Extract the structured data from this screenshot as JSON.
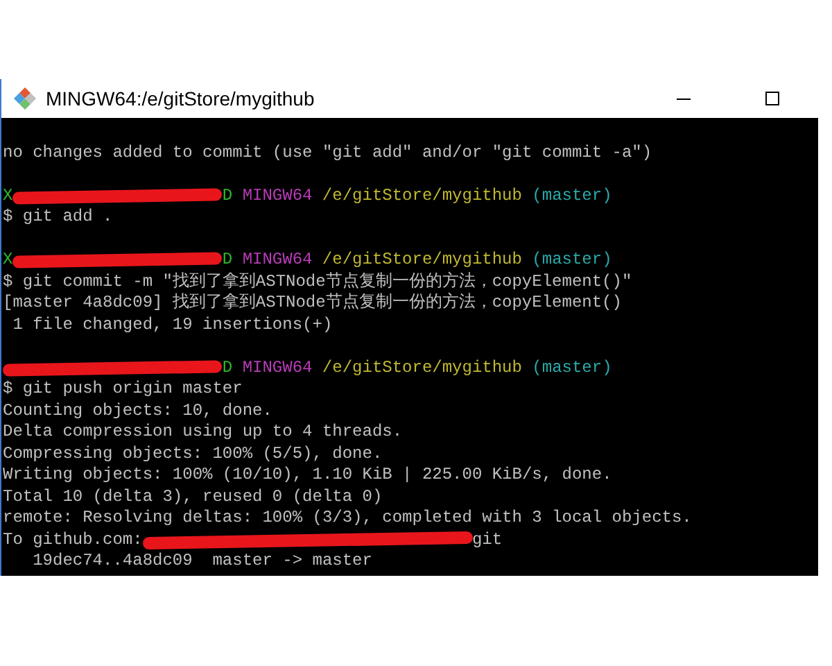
{
  "window": {
    "title": "MINGW64:/e/gitStore/mygithub",
    "controls": [
      {
        "kind": "minimize"
      },
      {
        "kind": "maximize"
      }
    ]
  },
  "terminal": {
    "lines": [
      {
        "kind": "blank"
      },
      {
        "kind": "output",
        "segments": [
          {
            "kind": "text",
            "text": "no changes added to commit (use \"git add\" and/or \"git commit -a\")",
            "color": "#c0c0c0"
          }
        ]
      },
      {
        "kind": "blank"
      },
      {
        "kind": "prompt",
        "segments": [
          {
            "kind": "text",
            "text": "X",
            "color": "#2eb82e"
          },
          {
            "kind": "redaction"
          },
          {
            "kind": "text",
            "text": "D",
            "color": "#2eb82e"
          },
          {
            "kind": "text",
            "text": " MINGW64",
            "color": "#b83cb8"
          },
          {
            "kind": "text",
            "text": " /e/gitStore/mygithub",
            "color": "#c0b830"
          },
          {
            "kind": "text",
            "text": " (master)",
            "color": "#2aa8a8"
          }
        ]
      },
      {
        "kind": "output",
        "segments": [
          {
            "kind": "text",
            "text": "$ git add .",
            "color": "#c0c0c0"
          }
        ]
      },
      {
        "kind": "blank"
      },
      {
        "kind": "prompt",
        "segments": [
          {
            "kind": "text",
            "text": "X",
            "color": "#2eb82e"
          },
          {
            "kind": "redaction"
          },
          {
            "kind": "text",
            "text": "D",
            "color": "#2eb82e"
          },
          {
            "kind": "text",
            "text": " MINGW64",
            "color": "#b83cb8"
          },
          {
            "kind": "text",
            "text": " /e/gitStore/mygithub",
            "color": "#c0b830"
          },
          {
            "kind": "text",
            "text": " (master)",
            "color": "#2aa8a8"
          }
        ]
      },
      {
        "kind": "output",
        "segments": [
          {
            "kind": "text",
            "text": "$ git commit -m \"找到了拿到ASTNode节点复制一份的方法，copyElement()\"",
            "color": "#c0c0c0"
          }
        ]
      },
      {
        "kind": "output",
        "segments": [
          {
            "kind": "text",
            "text": "[master 4a8dc09] 找到了拿到ASTNode节点复制一份的方法，copyElement()",
            "color": "#c0c0c0"
          }
        ]
      },
      {
        "kind": "output",
        "segments": [
          {
            "kind": "text",
            "text": " 1 file changed, 19 insertions(+)",
            "color": "#c0c0c0"
          }
        ]
      },
      {
        "kind": "blank"
      },
      {
        "kind": "prompt",
        "segments": [
          {
            "kind": "redaction"
          },
          {
            "kind": "text",
            "text": "D",
            "color": "#2eb82e"
          },
          {
            "kind": "text",
            "text": " MINGW64",
            "color": "#b83cb8"
          },
          {
            "kind": "text",
            "text": " /e/gitStore/mygithub",
            "color": "#c0b830"
          },
          {
            "kind": "text",
            "text": " (master)",
            "color": "#2aa8a8"
          }
        ]
      },
      {
        "kind": "output",
        "segments": [
          {
            "kind": "text",
            "text": "$ git push origin master",
            "color": "#c0c0c0"
          }
        ]
      },
      {
        "kind": "output",
        "segments": [
          {
            "kind": "text",
            "text": "Counting objects: 10, done.",
            "color": "#c0c0c0"
          }
        ]
      },
      {
        "kind": "output",
        "segments": [
          {
            "kind": "text",
            "text": "Delta compression using up to 4 threads.",
            "color": "#c0c0c0"
          }
        ]
      },
      {
        "kind": "output",
        "segments": [
          {
            "kind": "text",
            "text": "Compressing objects: 100% (5/5), done.",
            "color": "#c0c0c0"
          }
        ]
      },
      {
        "kind": "output",
        "segments": [
          {
            "kind": "text",
            "text": "Writing objects: 100% (10/10), 1.10 KiB | 225.00 KiB/s, done.",
            "color": "#c0c0c0"
          }
        ]
      },
      {
        "kind": "output",
        "segments": [
          {
            "kind": "text",
            "text": "Total 10 (delta 3), reused 0 (delta 0)",
            "color": "#c0c0c0"
          }
        ]
      },
      {
        "kind": "output",
        "segments": [
          {
            "kind": "text",
            "text": "remote: Resolving deltas: 100% (3/3), completed with 3 local objects.",
            "color": "#c0c0c0"
          }
        ]
      },
      {
        "kind": "output",
        "segments": [
          {
            "kind": "text",
            "text": "To github.com:",
            "color": "#c0c0c0"
          },
          {
            "kind": "redaction"
          },
          {
            "kind": "text",
            "text": "git",
            "color": "#c0c0c0"
          }
        ]
      },
      {
        "kind": "output",
        "segments": [
          {
            "kind": "text",
            "text": "   19dec74..4a8dc09  master -> master",
            "color": "#c0c0c0"
          }
        ]
      }
    ]
  }
}
